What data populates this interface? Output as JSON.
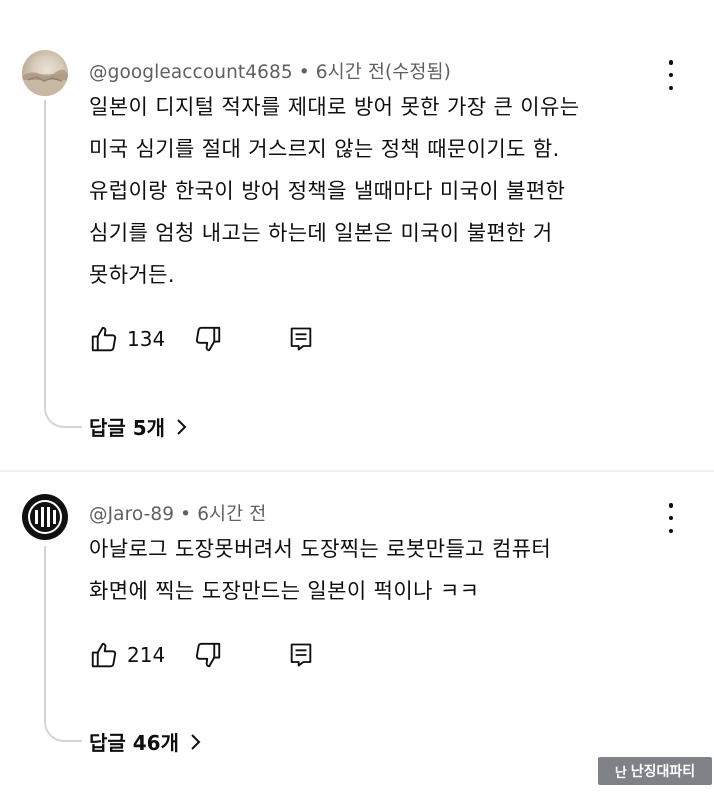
{
  "comments": [
    {
      "author": "@googleaccount4685",
      "separator": "•",
      "time": "6시간 전(수정됨)",
      "lines": [
        "일본이 디지털 적자를 제대로 방어 못한 가장 큰 이유는",
        "미국 심기를 절대 거스르지 않는 정책 때문이기도 함.",
        "유럽이랑 한국이 방어 정책을 낼때마다 미국이 불편한",
        "심기를 엄청 내고는 하는데 일본은 미국이 불편한 거",
        "못하거든."
      ],
      "likes": "134",
      "replies_label": "답글 5개",
      "avatar_icon": "landscape-avatar-icon"
    },
    {
      "author": "@Jaro-89",
      "separator": "•",
      "time": "6시간 전",
      "lines": [
        "아날로그 도장못버려서 도장찍는 로봇만들고 컴퓨터",
        "화면에 찍는 도장만드는 일본이 퍽이나 ㅋㅋ"
      ],
      "likes": "214",
      "replies_label": "답글 46개",
      "avatar_icon": "black-logo-avatar-icon"
    }
  ],
  "watermark": {
    "logo": "난",
    "text": "난징대파티"
  },
  "icons": {
    "like": "thumbs-up-icon",
    "dislike": "thumbs-down-icon",
    "reply": "reply-icon",
    "menu": "kebab-menu-icon",
    "chevron": "chevron-right-icon"
  },
  "colors": {
    "text": "#0f0f0f",
    "meta": "#606060",
    "thread_line": "#d4d4d4"
  }
}
